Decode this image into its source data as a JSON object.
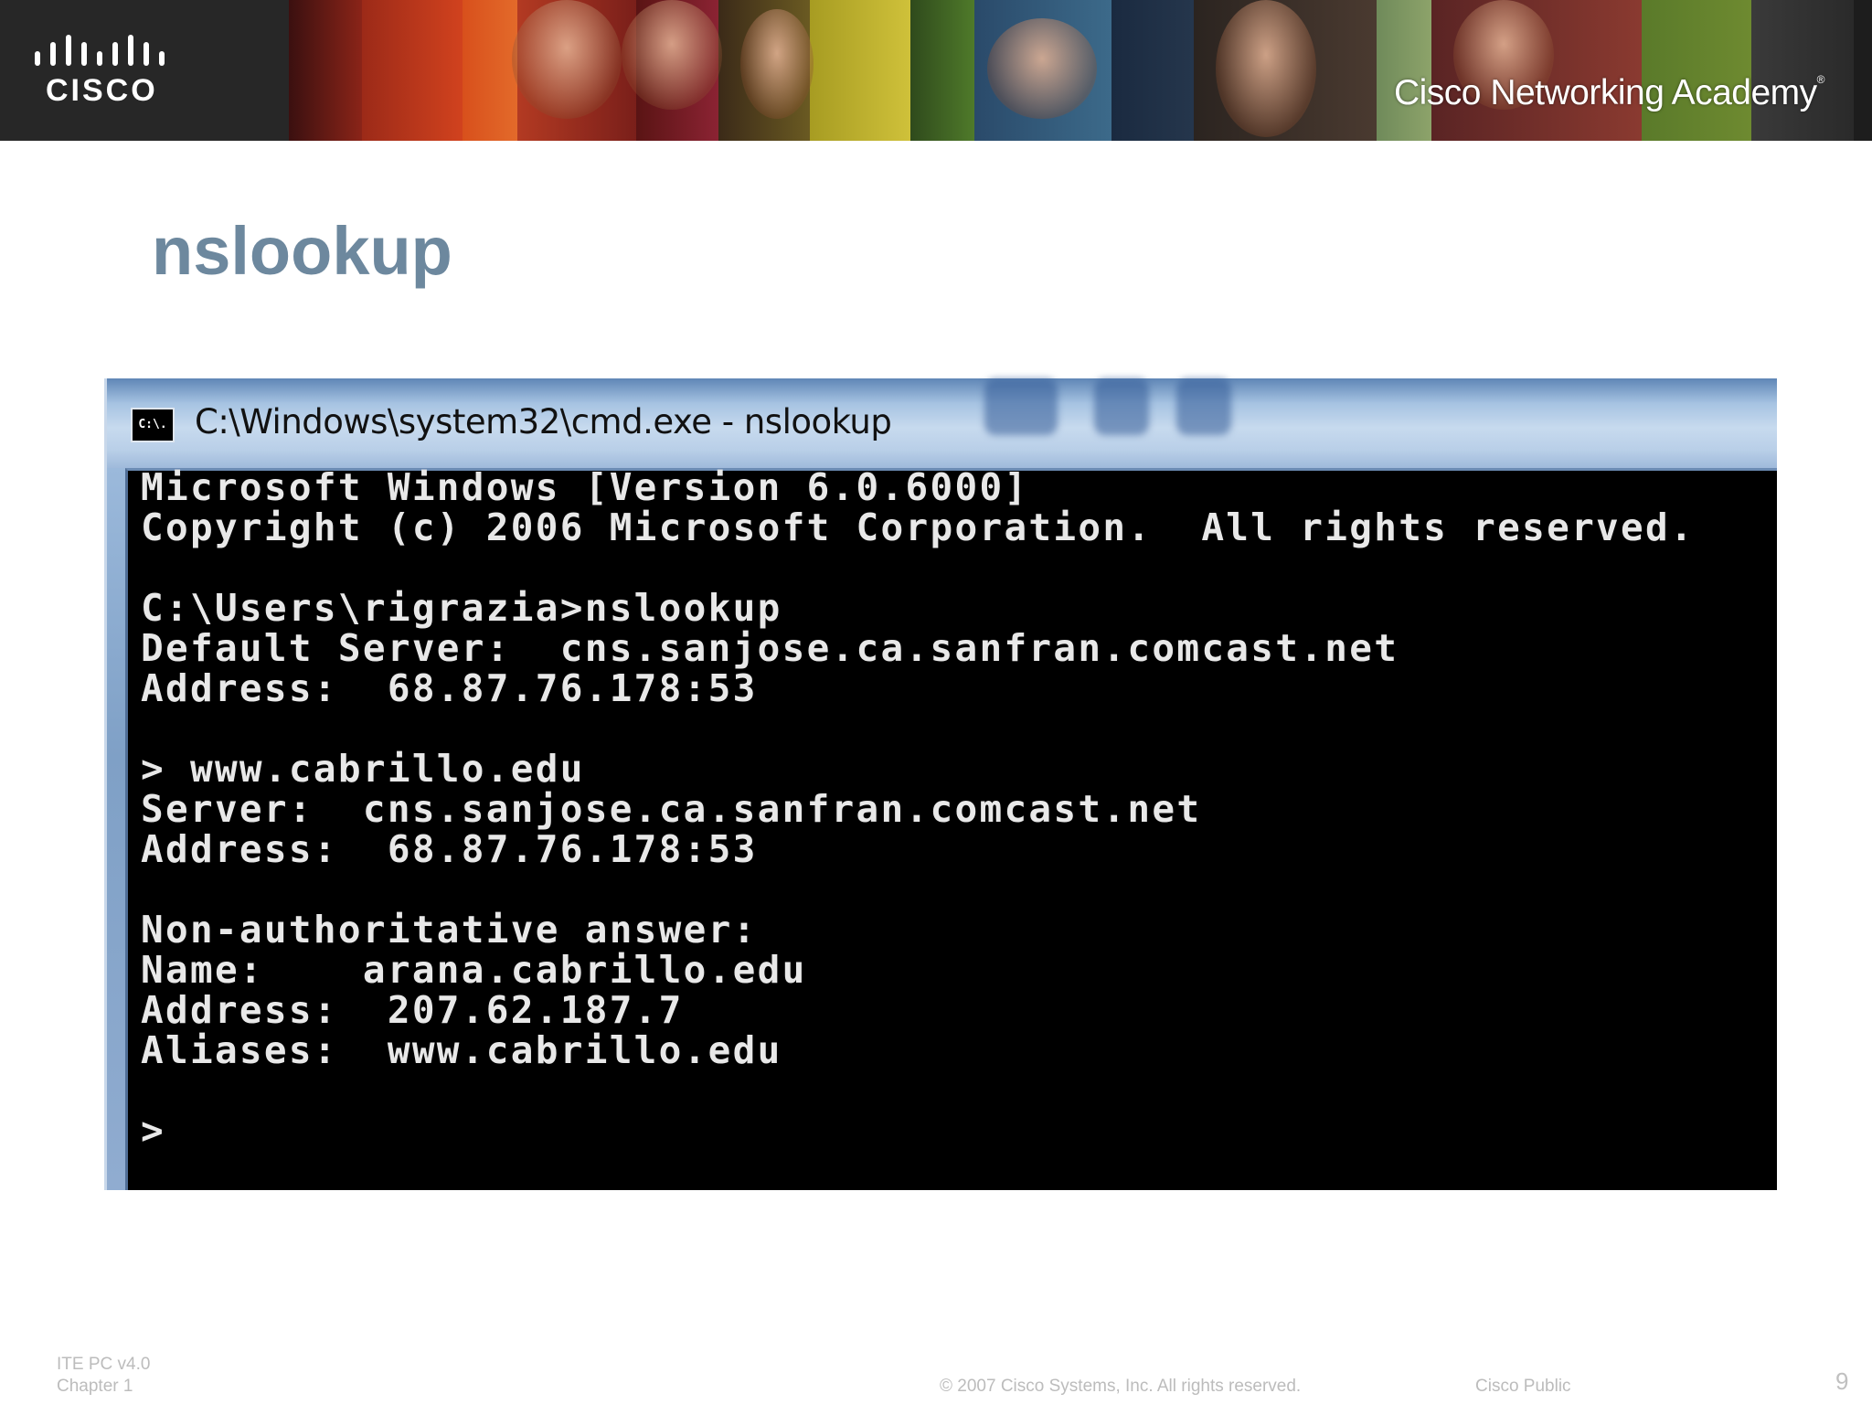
{
  "banner": {
    "logo_text": "CISCO",
    "academy_title": "Cisco Networking Academy",
    "academy_mark": "®"
  },
  "slide": {
    "title": "nslookup"
  },
  "cmd_window": {
    "icon_text": "C:\\.",
    "title": "C:\\Windows\\system32\\cmd.exe - nslookup",
    "lines": [
      "Microsoft Windows [Version 6.0.6000]",
      "Copyright (c) 2006 Microsoft Corporation.  All rights reserved.",
      "",
      "C:\\Users\\rigrazia>nslookup",
      "Default Server:  cns.sanjose.ca.sanfran.comcast.net",
      "Address:  68.87.76.178:53",
      "",
      "> www.cabrillo.edu",
      "Server:  cns.sanjose.ca.sanfran.comcast.net",
      "Address:  68.87.76.178:53",
      "",
      "Non-authoritative answer:",
      "Name:    arana.cabrillo.edu",
      "Address:  207.62.187.7",
      "Aliases:  www.cabrillo.edu",
      "",
      ">"
    ]
  },
  "footer": {
    "course": "ITE PC v4.0",
    "chapter": "Chapter 1",
    "copyright": "© 2007 Cisco Systems, Inc. All rights reserved.",
    "classification": "Cisco Public",
    "page_number": "9"
  },
  "colors": {
    "title": "#6d889e",
    "terminal_bg": "#000000",
    "terminal_text": "#e8e8e8",
    "footer_text": "#bcbcbc"
  }
}
